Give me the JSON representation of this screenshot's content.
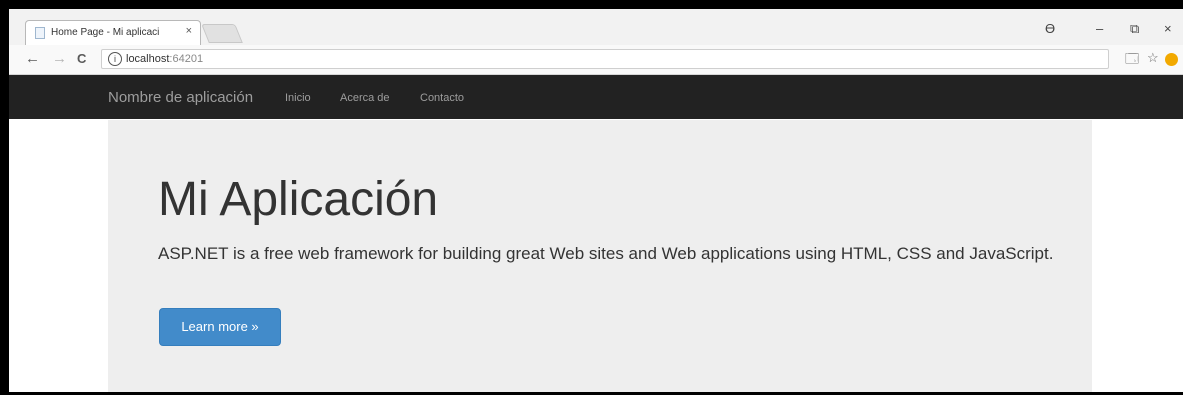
{
  "browser": {
    "tab_title": "Home Page - Mi aplicaci",
    "tab_close": "×",
    "url_host": "localhost",
    "url_port": ":64201",
    "nav_back": "←",
    "nav_forward": "→",
    "nav_reload": "C",
    "info_glyph": "i",
    "window_controls": {
      "account": "ϴ",
      "minimize": "–",
      "restore": "⧉",
      "close": "×"
    },
    "extensions": {
      "translate": "🗔",
      "bookmark": "☆"
    }
  },
  "navbar": {
    "brand": "Nombre de aplicación",
    "links": [
      "Inicio",
      "Acerca de",
      "Contacto"
    ]
  },
  "jumbotron": {
    "title": "Mi Aplicación",
    "lead": "ASP.NET is a free web framework for building great Web sites and Web applications using HTML, CSS and JavaScript.",
    "button_label": "Learn more »"
  },
  "colors": {
    "navbar_bg": "#222222",
    "navbar_text": "#9d9d9d",
    "jumbotron_bg": "#eeeeee",
    "primary_button": "#428bca"
  },
  "icons": [
    "favicon-icon",
    "close-icon",
    "back-icon",
    "forward-icon",
    "reload-icon",
    "info-icon",
    "translate-icon",
    "bookmark-star-icon",
    "extension-icon",
    "account-icon",
    "minimize-icon",
    "restore-icon"
  ]
}
